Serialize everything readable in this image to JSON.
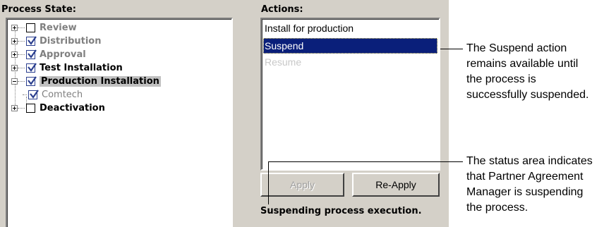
{
  "headers": {
    "process_state": "Process State:",
    "actions": "Actions:"
  },
  "tree": [
    {
      "label": "Review",
      "checked": false,
      "expander": "plus",
      "style": "gray"
    },
    {
      "label": "Distribution",
      "checked": true,
      "expander": "plus",
      "style": "gray"
    },
    {
      "label": "Approval",
      "checked": true,
      "expander": "plus",
      "style": "gray"
    },
    {
      "label": "Test Installation",
      "checked": true,
      "expander": "plus",
      "style": "black"
    },
    {
      "label": "Production Installation",
      "checked": true,
      "expander": "minus",
      "style": "black",
      "selected": true
    },
    {
      "label": "Comtech",
      "checked": true,
      "expander": "none",
      "style": "gray",
      "child": true
    },
    {
      "label": "Deactivation",
      "checked": false,
      "expander": "plus",
      "style": "black"
    }
  ],
  "actions": [
    {
      "label": "Install for production",
      "state": "normal"
    },
    {
      "label": "Suspend",
      "state": "selected"
    },
    {
      "label": "Resume",
      "state": "disabled"
    }
  ],
  "buttons": {
    "apply": "Apply",
    "reapply": "Re-Apply"
  },
  "status": "Suspending process execution.",
  "callouts": [
    [
      "The Suspend action",
      "remains available until",
      "the process is",
      "successfully suspended."
    ],
    [
      "The status area indicates",
      "that Partner Agreement",
      "Manager is suspending",
      "the process."
    ]
  ]
}
